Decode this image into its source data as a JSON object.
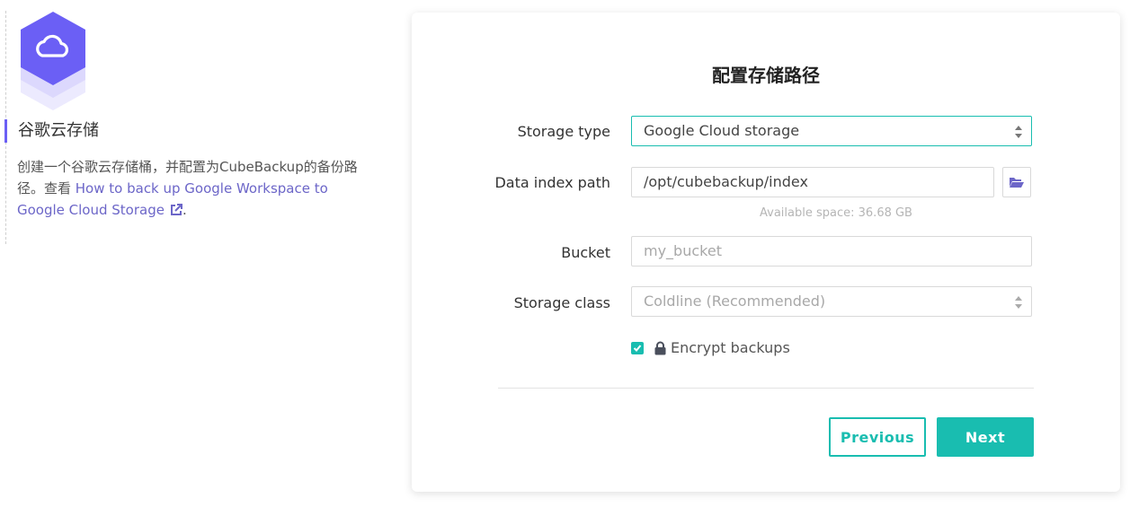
{
  "step": {
    "title": "谷歌云存储",
    "description_text": "创建一个谷歌云存储桶，并配置为CubeBackup的备份路径。查看 ",
    "help_link": "How to back up Google Workspace to Google Cloud Storage",
    "description_end": ".",
    "icon": "cloud-icon"
  },
  "form": {
    "title": "配置存储路径",
    "storage_type": {
      "label": "Storage type",
      "value": "Google Cloud storage"
    },
    "data_index_path": {
      "label": "Data index path",
      "value": "/opt/cubebackup/index",
      "hint": "Available space: 36.68 GB"
    },
    "bucket": {
      "label": "Bucket",
      "placeholder": "my_bucket"
    },
    "storage_class": {
      "label": "Storage class",
      "value": "Coldline (Recommended)"
    },
    "encrypt": {
      "label": "Encrypt backups",
      "checked": true
    }
  },
  "actions": {
    "previous": "Previous",
    "next": "Next"
  },
  "colors": {
    "accent": "#19bdb0",
    "brand": "#6b5ff5"
  }
}
